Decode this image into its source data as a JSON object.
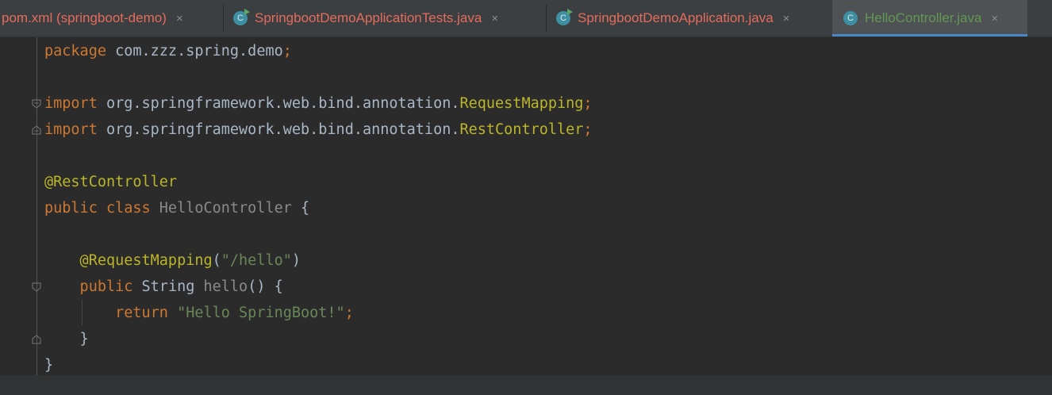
{
  "tabs": [
    {
      "label": "pom.xml (springboot-demo)",
      "close": "×",
      "active": false,
      "icon": ""
    },
    {
      "label": "SpringbootDemoApplicationTests.java",
      "close": "×",
      "active": false,
      "icon": "class-run-icon"
    },
    {
      "label": "SpringbootDemoApplication.java",
      "close": "×",
      "active": false,
      "icon": "class-run-icon"
    },
    {
      "label": "HelloController.java",
      "close": "×",
      "active": true,
      "icon": "class-icon"
    }
  ],
  "icon_letter": "C",
  "code": {
    "l1": {
      "kw": "package",
      "rest": " com.zzz.spring.demo",
      "semi": ";"
    },
    "l3": {
      "kw": "import",
      "path": " org.springframework.web.bind.annotation.",
      "cls": "RequestMapping",
      "semi": ";"
    },
    "l4": {
      "kw": "import",
      "path": " org.springframework.web.bind.annotation.",
      "cls": "RestController",
      "semi": ";"
    },
    "l6": {
      "ann": "@RestController"
    },
    "l7": {
      "kw1": "public",
      "kw2": " class",
      "name": " HelloController",
      "brace": " {"
    },
    "l9": {
      "ann": "    @RequestMapping",
      "open": "(",
      "str": "\"/hello\"",
      "close": ")"
    },
    "l10": {
      "kw": "    public",
      "type": " String",
      "name": " hello",
      "rest": "() {"
    },
    "l11": {
      "kw": "        return",
      "str": " \"Hello SpringBoot!\"",
      "semi": ";"
    },
    "l12": {
      "brace": "    }"
    },
    "l13": {
      "brace": "}"
    }
  },
  "colors": {
    "background": "#2b2b2b",
    "keyword": "#cc7832",
    "annotation": "#bbb529",
    "string": "#6a8759",
    "text": "#a9b7c6",
    "inactive_tab_text": "#e46c5c",
    "active_tab_text": "#629755",
    "active_tab_underline": "#4a88c7"
  }
}
